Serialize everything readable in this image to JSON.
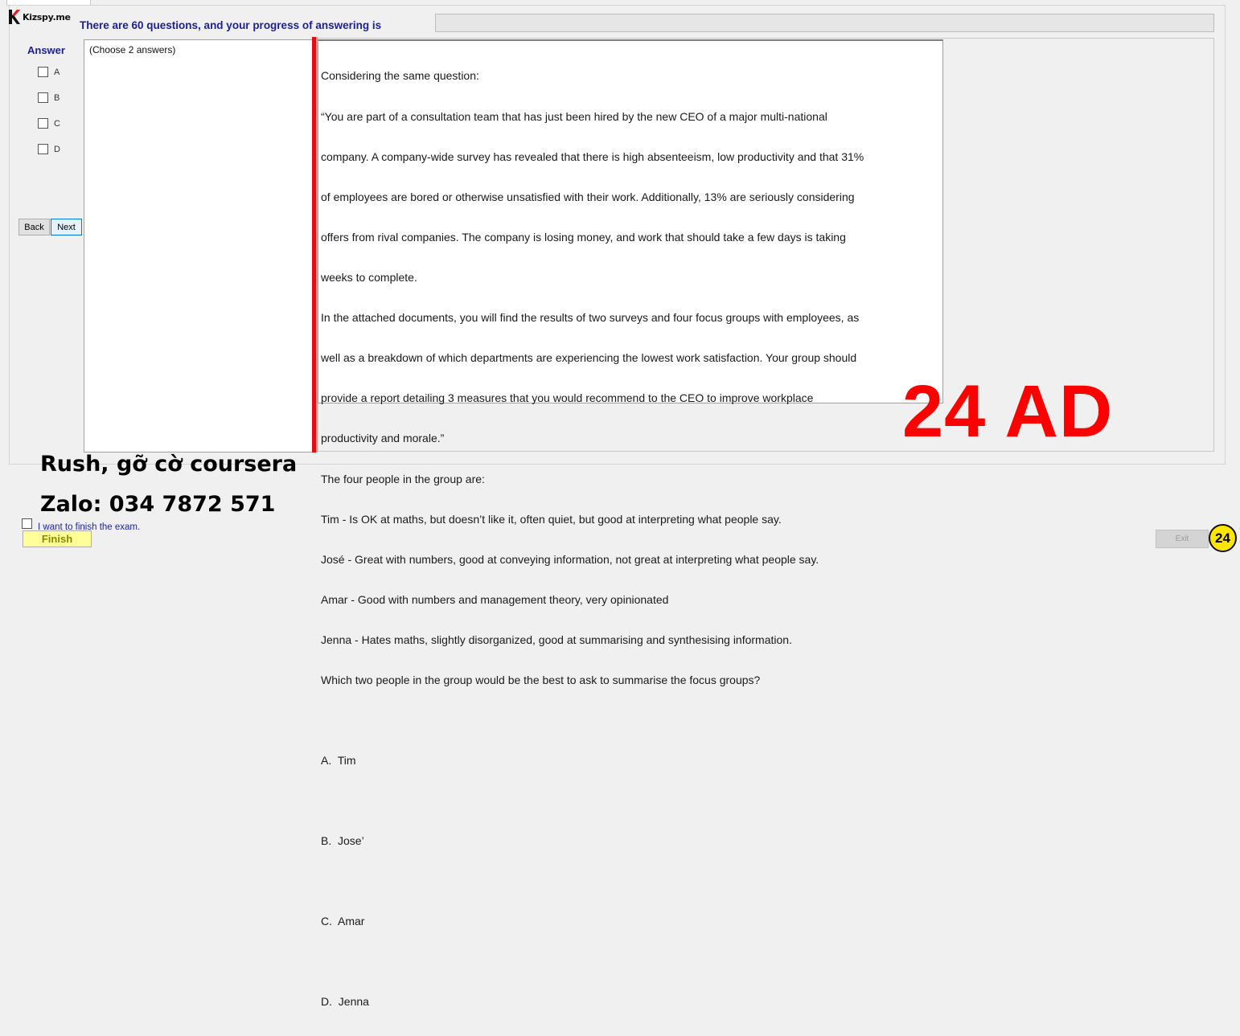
{
  "header": {
    "logo_text": "Kizspy.me",
    "progress_text": "There are 60 questions, and your progress of answering is",
    "progress_fraction": 0
  },
  "answer_panel": {
    "label": "Answer",
    "options": [
      "A",
      "B",
      "C",
      "D"
    ],
    "back_label": "Back",
    "next_label": "Next"
  },
  "choose_note": "(Choose 2 answers)",
  "question": {
    "lines": [
      "Considering the same question:",
      "“You are part of a consultation team that has just been hired by the new CEO of a major multi-national",
      "company. A company-wide survey has revealed that there is high absenteeism, low productivity and that 31%",
      "of employees are bored or otherwise unsatisfied with their work. Additionally, 13% are seriously considering",
      "offers from rival companies. The company is losing money, and work that should take a few days is taking",
      "weeks to complete.",
      "In the attached documents, you will find the results of two surveys and four focus groups with employees, as",
      "well as a breakdown of which departments are experiencing the lowest work satisfaction. Your group should",
      "provide a report detailing 3 measures that you would recommend to the CEO to improve workplace",
      "productivity and morale.”",
      "The four people in the group are:",
      "Tim - Is OK at maths, but doesn’t like it, often quiet, but good at interpreting what people say.",
      "José - Great with numbers, good at conveying information, not great at interpreting what people say.",
      "Amar - Good with numbers and management theory, very opinionated",
      "Jenna - Hates maths, slightly disorganized, good at summarising and synthesising information.",
      "Which two people in the group would be the best to ask to summarise the focus groups?"
    ],
    "choices": [
      "A.  Tim",
      "B.  Jose’",
      "C.  Amar",
      "D.  Jenna"
    ]
  },
  "overlay": {
    "answer_mark": "24 AD",
    "promo_line1": "Rush, gỡ cờ coursera",
    "promo_line2": "Zalo: 034 7872 571",
    "badge": "24"
  },
  "footer": {
    "finish_check_label": "I want to finish the exam.",
    "finish_label": "Finish",
    "exit_label": "Exit"
  },
  "colors": {
    "heading_blue": "#1c1f9e",
    "overlay_red": "#ff0000",
    "finish_yellow": "#ffff99",
    "badge_yellow": "#ffe600",
    "divider_red": "#e01010"
  }
}
